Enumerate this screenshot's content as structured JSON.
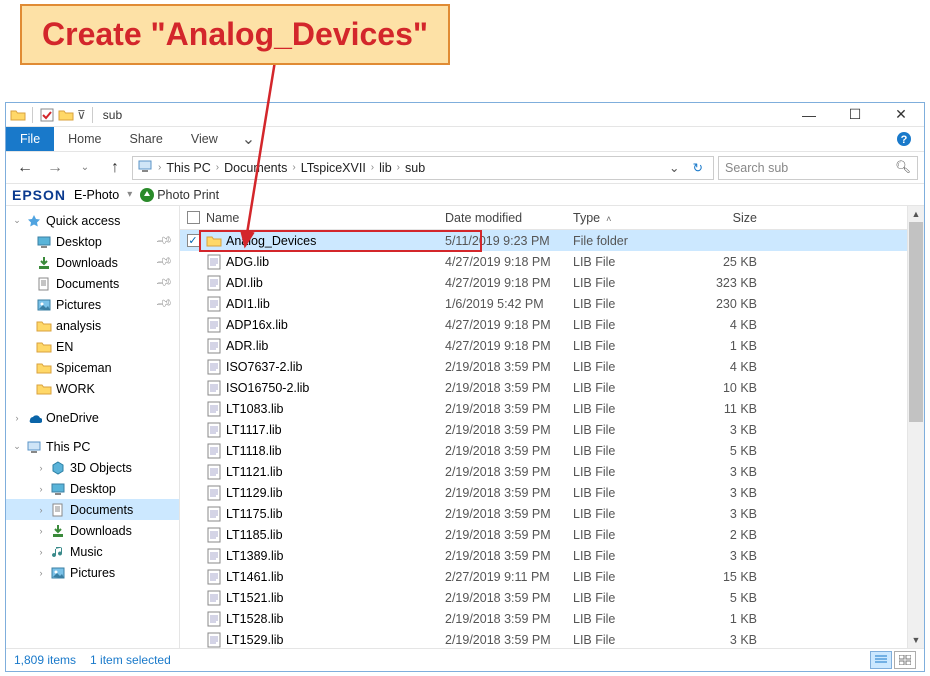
{
  "callout": {
    "text": "Create \"Analog_Devices\""
  },
  "window": {
    "title": "sub",
    "file_tab": "File",
    "tabs": [
      "Home",
      "Share",
      "View"
    ],
    "breadcrumbs": [
      "This PC",
      "Documents",
      "LTspiceXVII",
      "lib",
      "sub"
    ],
    "search_placeholder": "Search sub",
    "epson": {
      "logo": "EPSON",
      "ephoto": "E-Photo",
      "print": "Photo Print"
    },
    "nav": {
      "quick": "Quick access",
      "quick_items": [
        {
          "label": "Desktop",
          "pin": true,
          "icon": "desktop"
        },
        {
          "label": "Downloads",
          "pin": true,
          "icon": "downloads"
        },
        {
          "label": "Documents",
          "pin": true,
          "icon": "documents"
        },
        {
          "label": "Pictures",
          "pin": true,
          "icon": "pictures"
        },
        {
          "label": "analysis",
          "pin": false,
          "icon": "folder"
        },
        {
          "label": "EN",
          "pin": false,
          "icon": "folder"
        },
        {
          "label": "Spiceman",
          "pin": false,
          "icon": "folder"
        },
        {
          "label": "WORK",
          "pin": false,
          "icon": "folder"
        }
      ],
      "onedrive": "OneDrive",
      "thispc": "This PC",
      "pc_items": [
        {
          "label": "3D Objects",
          "icon": "3d"
        },
        {
          "label": "Desktop",
          "icon": "desktop"
        },
        {
          "label": "Documents",
          "icon": "documents",
          "selected": true
        },
        {
          "label": "Downloads",
          "icon": "downloads"
        },
        {
          "label": "Music",
          "icon": "music"
        },
        {
          "label": "Pictures",
          "icon": "pictures"
        }
      ]
    },
    "columns": {
      "name": "Name",
      "date": "Date modified",
      "type": "Type",
      "size": "Size"
    },
    "rows": [
      {
        "name": "Analog_Devices",
        "date": "5/11/2019 9:23 PM",
        "type": "File folder",
        "size": "",
        "icon": "folder",
        "selected": true
      },
      {
        "name": "ADG.lib",
        "date": "4/27/2019 9:18 PM",
        "type": "LIB File",
        "size": "25 KB",
        "icon": "lib"
      },
      {
        "name": "ADI.lib",
        "date": "4/27/2019 9:18 PM",
        "type": "LIB File",
        "size": "323 KB",
        "icon": "lib"
      },
      {
        "name": "ADI1.lib",
        "date": "1/6/2019 5:42 PM",
        "type": "LIB File",
        "size": "230 KB",
        "icon": "lib"
      },
      {
        "name": "ADP16x.lib",
        "date": "4/27/2019 9:18 PM",
        "type": "LIB File",
        "size": "4 KB",
        "icon": "lib"
      },
      {
        "name": "ADR.lib",
        "date": "4/27/2019 9:18 PM",
        "type": "LIB File",
        "size": "1 KB",
        "icon": "lib"
      },
      {
        "name": "ISO7637-2.lib",
        "date": "2/19/2018 3:59 PM",
        "type": "LIB File",
        "size": "4 KB",
        "icon": "lib"
      },
      {
        "name": "ISO16750-2.lib",
        "date": "2/19/2018 3:59 PM",
        "type": "LIB File",
        "size": "10 KB",
        "icon": "lib"
      },
      {
        "name": "LT1083.lib",
        "date": "2/19/2018 3:59 PM",
        "type": "LIB File",
        "size": "11 KB",
        "icon": "lib"
      },
      {
        "name": "LT1117.lib",
        "date": "2/19/2018 3:59 PM",
        "type": "LIB File",
        "size": "3 KB",
        "icon": "lib"
      },
      {
        "name": "LT1118.lib",
        "date": "2/19/2018 3:59 PM",
        "type": "LIB File",
        "size": "5 KB",
        "icon": "lib"
      },
      {
        "name": "LT1121.lib",
        "date": "2/19/2018 3:59 PM",
        "type": "LIB File",
        "size": "3 KB",
        "icon": "lib"
      },
      {
        "name": "LT1129.lib",
        "date": "2/19/2018 3:59 PM",
        "type": "LIB File",
        "size": "3 KB",
        "icon": "lib"
      },
      {
        "name": "LT1175.lib",
        "date": "2/19/2018 3:59 PM",
        "type": "LIB File",
        "size": "3 KB",
        "icon": "lib"
      },
      {
        "name": "LT1185.lib",
        "date": "2/19/2018 3:59 PM",
        "type": "LIB File",
        "size": "2 KB",
        "icon": "lib"
      },
      {
        "name": "LT1389.lib",
        "date": "2/19/2018 3:59 PM",
        "type": "LIB File",
        "size": "3 KB",
        "icon": "lib"
      },
      {
        "name": "LT1461.lib",
        "date": "2/27/2019 9:11 PM",
        "type": "LIB File",
        "size": "15 KB",
        "icon": "lib"
      },
      {
        "name": "LT1521.lib",
        "date": "2/19/2018 3:59 PM",
        "type": "LIB File",
        "size": "5 KB",
        "icon": "lib"
      },
      {
        "name": "LT1528.lib",
        "date": "2/19/2018 3:59 PM",
        "type": "LIB File",
        "size": "1 KB",
        "icon": "lib"
      },
      {
        "name": "LT1529.lib",
        "date": "2/19/2018 3:59 PM",
        "type": "LIB File",
        "size": "3 KB",
        "icon": "lib"
      }
    ],
    "status": {
      "items": "1,809 items",
      "selected": "1 item selected"
    }
  }
}
